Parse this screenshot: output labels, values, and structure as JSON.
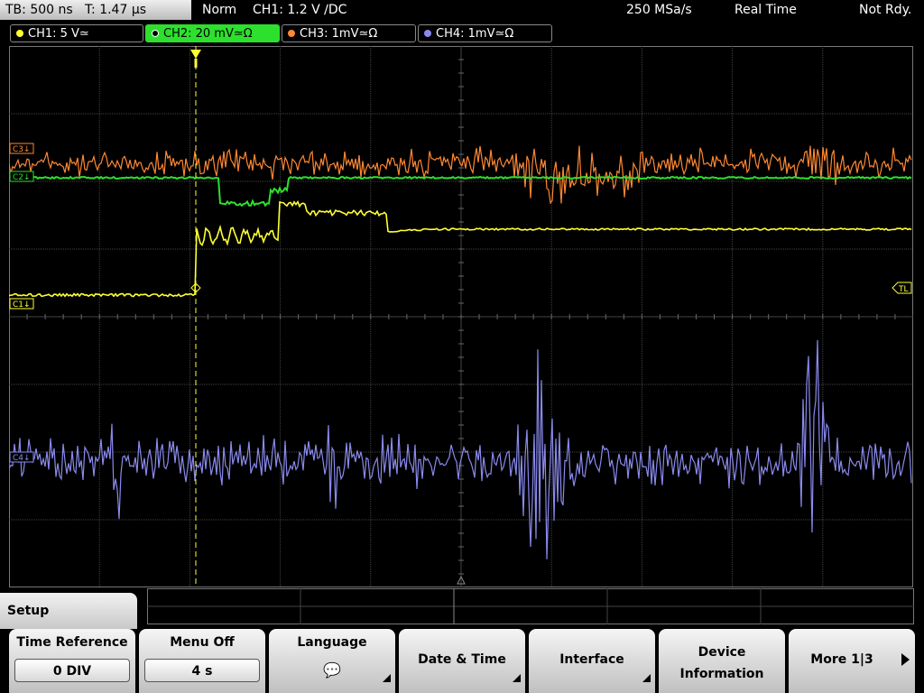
{
  "status_bar": {
    "timebase": "TB: 500 ns   T: 1.47 µs",
    "mode": "Norm",
    "trigger": "CH1: 1.2 V ∕DC",
    "sample_rate": "250 MSa/s",
    "acq": "Real Time",
    "state": "Not Rdy."
  },
  "channels": [
    {
      "label": "CH1: 5 V≃",
      "color": "#ffff33"
    },
    {
      "label": "CH2: 20 mV≃Ω",
      "color": "#2de02d"
    },
    {
      "label": "CH3: 1mV≃Ω",
      "color": "#ff8833"
    },
    {
      "label": "CH4: 1mV≃Ω",
      "color": "#8a8aee"
    }
  ],
  "markers": {
    "c3": "C3↓",
    "c2": "C2↓",
    "c1": "C1↓",
    "c4": "C4↓",
    "tl": "TL"
  },
  "menu": {
    "title": "Setup",
    "softkeys": [
      {
        "label": "Time Reference",
        "value": "0 DIV"
      },
      {
        "label": "Menu Off",
        "value": "4 s"
      },
      {
        "label": "Language",
        "icon": "speech-bubbles-icon"
      },
      {
        "label": "Date & Time"
      },
      {
        "label": "Interface"
      },
      {
        "label": "Device\nInformation"
      },
      {
        "label": "More 1|3"
      }
    ]
  },
  "colors": {
    "ch1": "#ffff33",
    "ch2": "#2de02d",
    "ch3": "#ff8833",
    "ch4": "#8a8aee",
    "grid": "#555555"
  }
}
